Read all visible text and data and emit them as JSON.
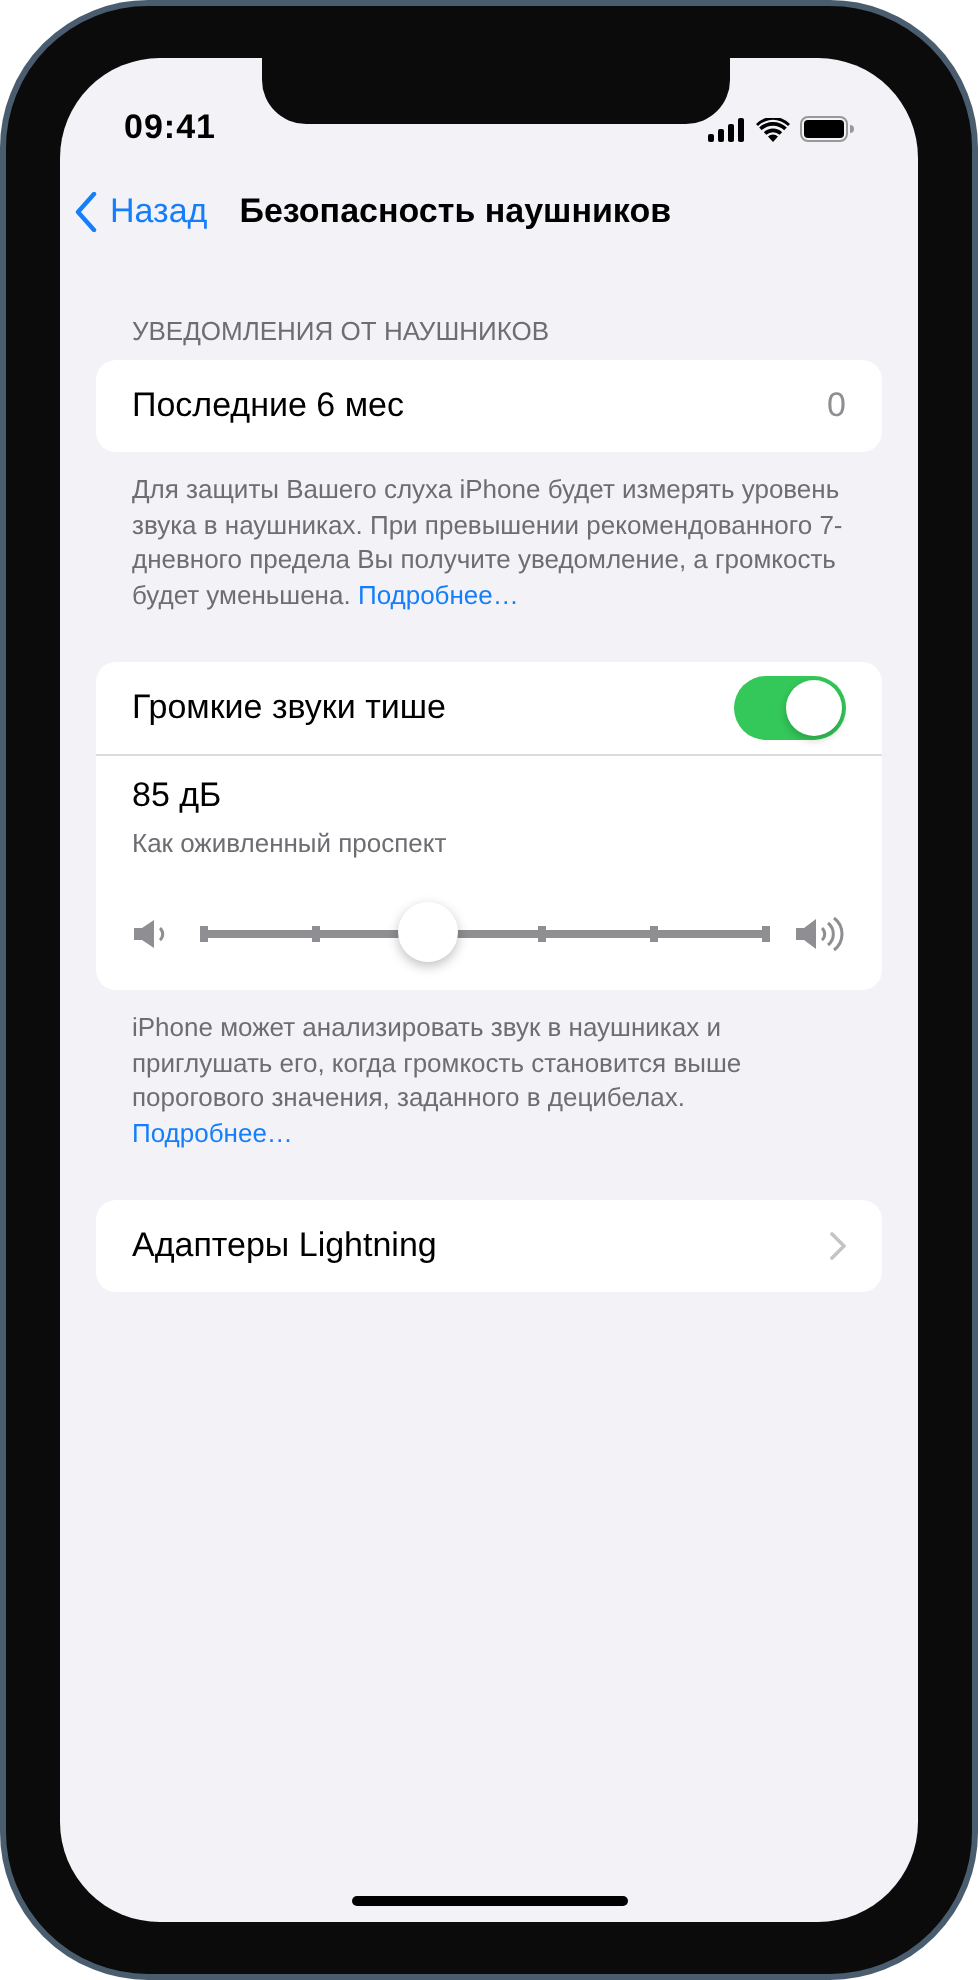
{
  "status_bar": {
    "time": "09:41"
  },
  "nav": {
    "back": "Назад",
    "title": "Безопасность наушников"
  },
  "sections": [
    {
      "header": "УВЕДОМЛЕНИЯ ОТ НАУШНИКОВ",
      "rows": [
        {
          "kind": "value",
          "label": "Последние 6 мес",
          "value": "0"
        }
      ],
      "footer": {
        "text": "Для защиты Вашего слуха iPhone будет измерять уровень звука в наушниках. При превышении рекомендованного 7-дневного предела Вы получите уведомление, а громкость будет уменьшена.",
        "link": "Подробнее…"
      }
    },
    {
      "rows": [
        {
          "kind": "toggle",
          "label": "Громкие звуки тише",
          "on": true
        },
        {
          "kind": "slider",
          "reading": "85 дБ",
          "caption": "Как оживленный проспект",
          "level": 0.4
        }
      ],
      "footer": {
        "text": "iPhone может анализировать звук в наушниках и приглушать его, когда громкость становится выше порогового значения, заданного в децибелах.",
        "link": "Подробнее…"
      }
    },
    {
      "rows": [
        {
          "kind": "link",
          "label": "Адаптеры Lightning"
        }
      ]
    }
  ]
}
